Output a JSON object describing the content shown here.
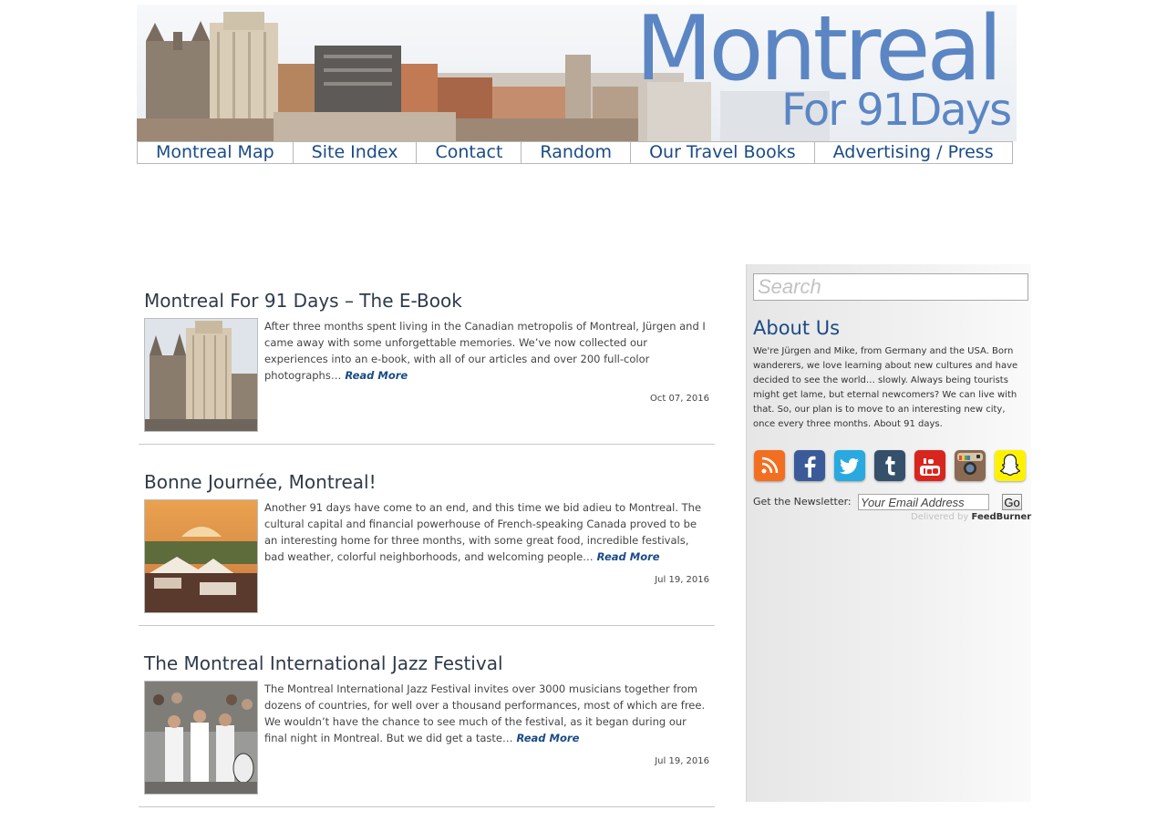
{
  "header": {
    "title": "Montreal",
    "subtitle": "For 91Days"
  },
  "nav": {
    "items": [
      {
        "label": "Montreal Map"
      },
      {
        "label": "Site Index"
      },
      {
        "label": "Contact"
      },
      {
        "label": "Random"
      },
      {
        "label": "Our Travel Books"
      },
      {
        "label": "Advertising / Press"
      }
    ]
  },
  "posts": [
    {
      "title": "Montreal For 91 Days – The E-Book",
      "excerpt": "After three months spent living in the Canadian metropolis of Montreal, Jürgen and I came away with some unforgettable memories. We’ve now collected our experiences into an e-book, with all of our articles and over 200 full-color photographs…",
      "read_more": "Read More",
      "date": "Oct 07, 2016"
    },
    {
      "title": "Bonne Journée, Montreal!",
      "excerpt": "Another 91 days have come to an end, and this time we bid adieu to Montreal. The cultural capital and financial powerhouse of French-speaking Canada proved to be an interesting home for three months, with some great food, incredible festivals, bad weather, colorful neighborhoods, and welcoming people…",
      "read_more": "Read More",
      "date": "Jul 19, 2016"
    },
    {
      "title": "The Montreal International Jazz Festival",
      "excerpt": "The Montreal International Jazz Festival invites over 3000 musicians together from dozens of countries, for well over a thousand performances, most of which are free. We wouldn’t have the chance to see much of the festival, as it began during our final night in Montreal. But we did get a taste…",
      "read_more": "Read More",
      "date": "Jul 19, 2016"
    }
  ],
  "sidebar": {
    "search_placeholder": "Search",
    "about_title": "About Us",
    "about_text": "We're Jürgen and Mike, from Germany and the USA. Born wanderers, we love learning about new cultures and have decided to see the world… slowly. Always being tourists might get lame, but eternal newcomers? We can live with that. So, our plan is to move to an interesting new city, once every three months. About 91 days.",
    "social": [
      {
        "icon": "rss-icon",
        "color": "#f26f21"
      },
      {
        "icon": "facebook-icon",
        "color": "#3b5a9a"
      },
      {
        "icon": "twitter-icon",
        "color": "#29a9df"
      },
      {
        "icon": "tumblr-icon",
        "color": "#35506b"
      },
      {
        "icon": "youtube-icon",
        "color": "#d8261e"
      },
      {
        "icon": "instagram-icon",
        "color": "#8a6a52"
      },
      {
        "icon": "snapchat-icon",
        "color": "#fff200"
      }
    ],
    "newsletter": {
      "label": "Get the Newsletter:",
      "email_placeholder": "Your Email Address",
      "go_label": "Go",
      "delivered_by": "Delivered by",
      "feedburner": "FeedBurner"
    }
  },
  "colors": {
    "accent": "#1a4b86",
    "title_blue": "#5b86c3"
  }
}
